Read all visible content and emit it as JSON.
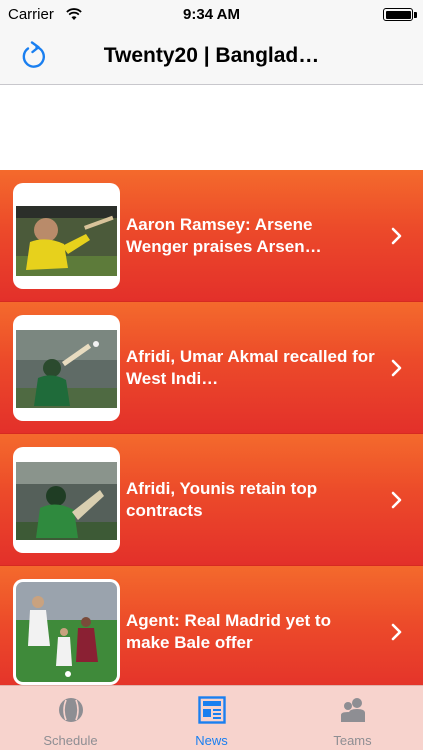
{
  "status_bar": {
    "carrier": "Carrier",
    "time": "9:34 AM",
    "battery_level": 1.0
  },
  "nav": {
    "title": "Twenty20 | Banglad…",
    "refresh_icon": "refresh-icon"
  },
  "news": [
    {
      "title": "Aaron Ramsey: Arsene Wenger praises Arsen…",
      "thumb": "player-in-yellow-kit-image"
    },
    {
      "title": "Afridi, Umar Akmal recalled for West Indi…",
      "thumb": "batsman-hitting-ball-image"
    },
    {
      "title": "Afridi, Younis retain top contracts",
      "thumb": "batsman-in-green-kit-image"
    },
    {
      "title": "Agent: Real Madrid yet to make Bale offer",
      "thumb": "football-match-image"
    }
  ],
  "tabs": [
    {
      "label": "Schedule",
      "icon": "cricket-ball-icon",
      "active": false
    },
    {
      "label": "News",
      "icon": "newspaper-icon",
      "active": true
    },
    {
      "label": "Teams",
      "icon": "people-icon",
      "active": false
    }
  ],
  "colors": {
    "row_top": "#f46a2c",
    "row_bottom": "#e3302a",
    "tab_active": "#1a7ff0",
    "tab_inactive": "#8e8e93",
    "tab_bar_bg": "#f7d3cd"
  }
}
